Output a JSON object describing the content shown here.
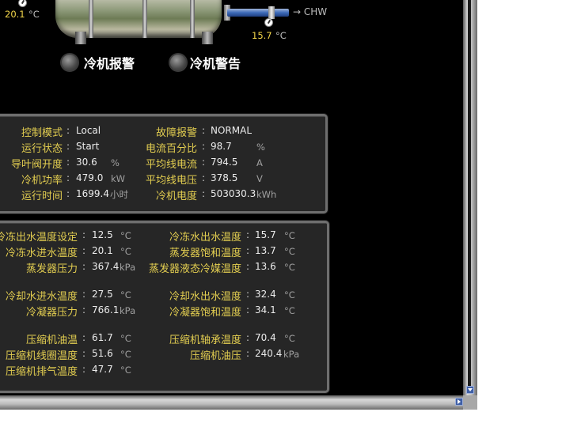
{
  "chiller_graphic": {
    "inlet_temp": "20.1",
    "inlet_unit": "°C",
    "outlet_temp": "15.7",
    "outlet_unit": "°C",
    "chw_label": "→ CHW"
  },
  "alarms": {
    "alarm_label": "冷机报警",
    "warning_label": "冷机警告"
  },
  "status_panel": {
    "left": [
      {
        "label": "控制模式",
        "value": "Local",
        "unit": ""
      },
      {
        "label": "运行状态",
        "value": "Start",
        "unit": ""
      },
      {
        "label": "导叶阀开度",
        "value": "30.6",
        "unit": "%"
      },
      {
        "label": "冷机功率",
        "value": "479.0",
        "unit": "kW"
      },
      {
        "label": "运行时间",
        "value": "1699.4",
        "unit": "小时"
      }
    ],
    "right": [
      {
        "label": "故障报警",
        "value": "NORMAL",
        "unit": ""
      },
      {
        "label": "电流百分比",
        "value": "98.7",
        "unit": "%"
      },
      {
        "label": "平均线电流",
        "value": "794.5",
        "unit": "A"
      },
      {
        "label": "平均线电压",
        "value": "378.5",
        "unit": "V"
      },
      {
        "label": "冷机电度",
        "value": "503030.3",
        "unit": "kWh"
      }
    ]
  },
  "temp_panel": {
    "left": [
      {
        "label": "冷冻出水温度设定",
        "value": "12.5",
        "unit": "°C"
      },
      {
        "label": "冷冻水进水温度",
        "value": "20.1",
        "unit": "°C"
      },
      {
        "label": "蒸发器压力",
        "value": "367.4",
        "unit": "kPa"
      },
      {
        "label": "冷却水进水温度",
        "value": "27.5",
        "unit": "°C"
      },
      {
        "label": "冷凝器压力",
        "value": "766.1",
        "unit": "kPa"
      },
      {
        "label": "压缩机油温",
        "value": "61.7",
        "unit": "°C"
      },
      {
        "label": "压缩机线圈温度",
        "value": "51.6",
        "unit": "°C"
      },
      {
        "label": "压缩机排气温度",
        "value": "47.7",
        "unit": "°C"
      }
    ],
    "right": [
      {
        "label": "冷冻水出水温度",
        "value": "15.7",
        "unit": "°C"
      },
      {
        "label": "蒸发器饱和温度",
        "value": "13.7",
        "unit": "°C"
      },
      {
        "label": "蒸发器液态冷媒温度",
        "value": "13.6",
        "unit": "°C"
      },
      {
        "label": "冷却水出水温度",
        "value": "32.4",
        "unit": "°C"
      },
      {
        "label": "冷凝器饱和温度",
        "value": "34.1",
        "unit": "°C"
      },
      {
        "label": "压缩机轴承温度",
        "value": "70.4",
        "unit": "°C"
      },
      {
        "label": "压缩机油压",
        "value": "240.4",
        "unit": "kPa"
      }
    ]
  },
  "colors": {
    "label": "#e2cd50",
    "value": "#ececec",
    "panel_bg": "#262626",
    "page_bg": "#000000"
  }
}
